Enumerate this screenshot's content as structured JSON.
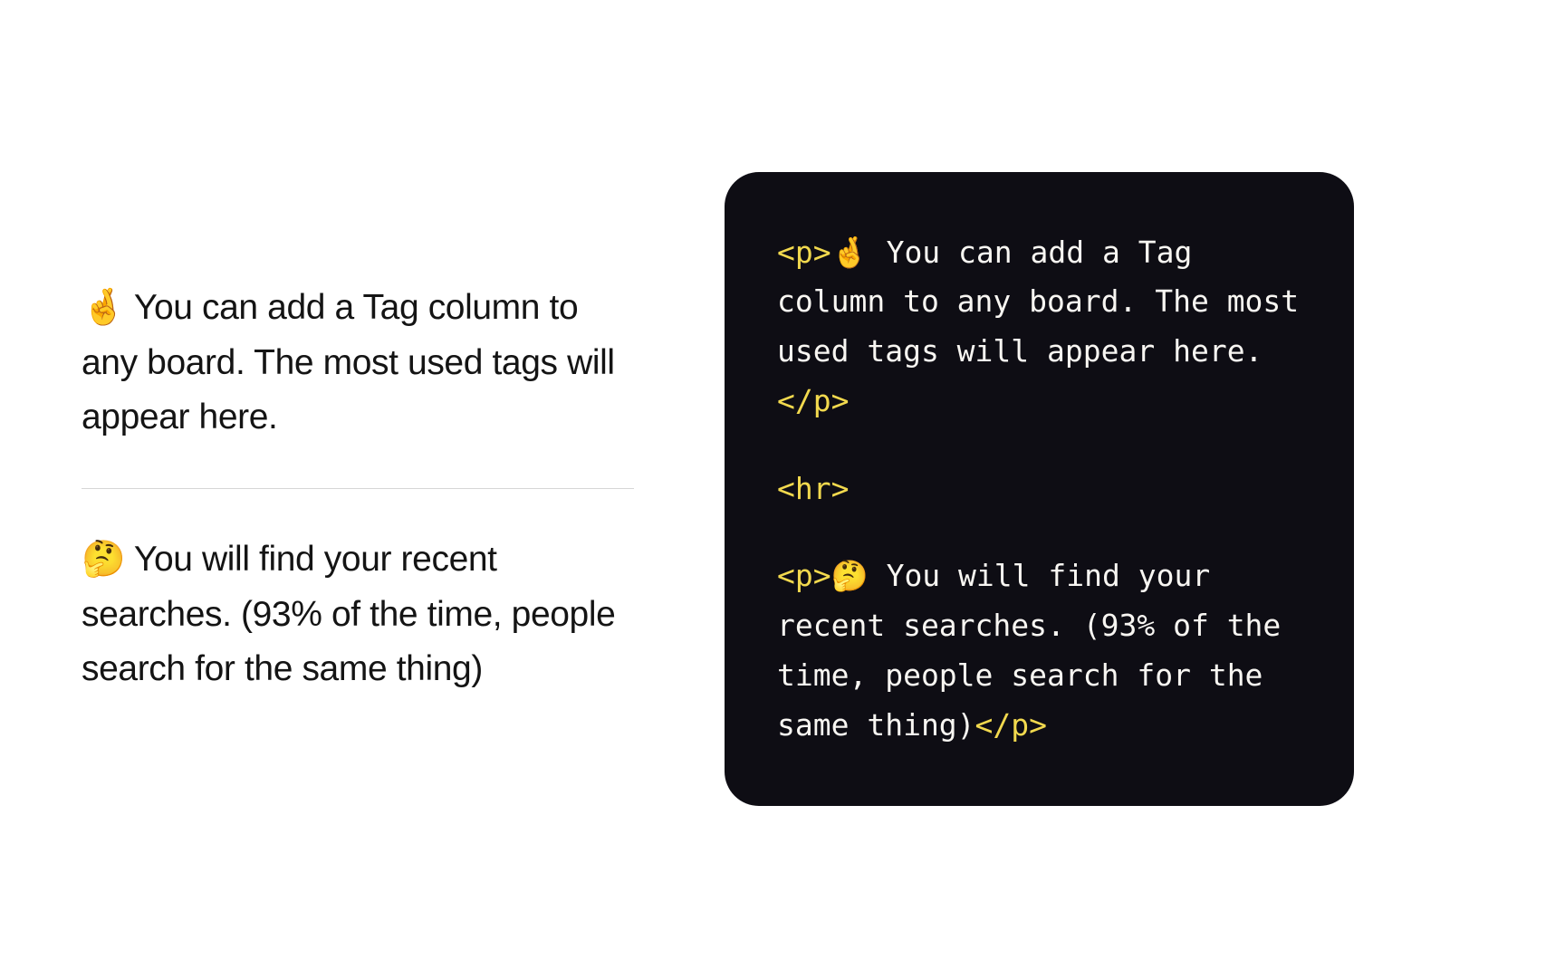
{
  "rendered": {
    "paragraph1": "🤞 You can add a Tag column to any board. The most used tags will appear here.",
    "paragraph2": "🤔 You will find your recent searches. (93% of the time, people search for the same thing)"
  },
  "code": {
    "p1_open": "<p>",
    "p1_emoji": "🤞",
    "p1_text": " You can add a Tag column to any board. The most used tags will appear here.",
    "p1_close": "</p>",
    "hr_tag": "<hr>",
    "p2_open": "<p>",
    "p2_emoji": "🤔",
    "p2_text": " You will find your recent searches. (93% of the time, people search for the same thing)",
    "p2_close": "</p>"
  }
}
